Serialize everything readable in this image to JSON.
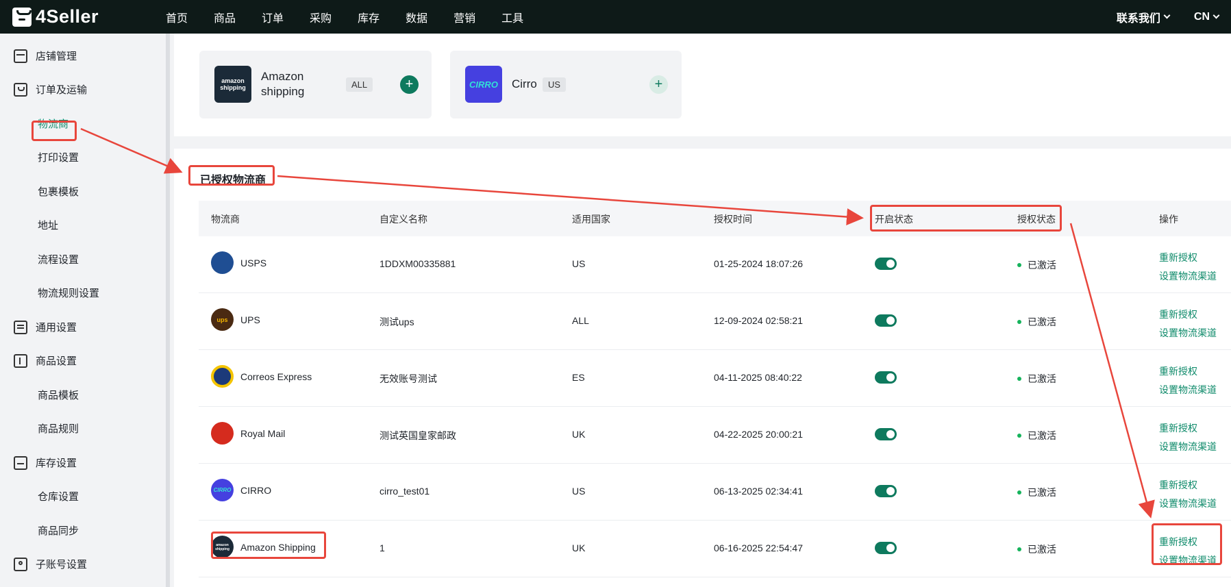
{
  "app": {
    "logo": "4Seller"
  },
  "topnav": [
    "首页",
    "商品",
    "订单",
    "采购",
    "库存",
    "数据",
    "营销",
    "工具"
  ],
  "top_right": {
    "contact": "联系我们",
    "lang": "CN"
  },
  "sidebar": {
    "items": [
      {
        "label": "店铺管理",
        "level": 1,
        "icon": "store-icon"
      },
      {
        "label": "订单及运输",
        "level": 1,
        "icon": "bag-icon"
      },
      {
        "label": "物流商",
        "level": 2,
        "active": true
      },
      {
        "label": "打印设置",
        "level": 2
      },
      {
        "label": "包裹模板",
        "level": 2
      },
      {
        "label": "地址",
        "level": 2
      },
      {
        "label": "流程设置",
        "level": 2
      },
      {
        "label": "物流规则设置",
        "level": 2
      },
      {
        "label": "通用设置",
        "level": 1,
        "icon": "document-icon"
      },
      {
        "label": "商品设置",
        "level": 1,
        "icon": "upload-icon"
      },
      {
        "label": "商品模板",
        "level": 2
      },
      {
        "label": "商品规则",
        "level": 2
      },
      {
        "label": "库存设置",
        "level": 1,
        "icon": "warehouse-icon"
      },
      {
        "label": "仓库设置",
        "level": 2
      },
      {
        "label": "商品同步",
        "level": 2
      },
      {
        "label": "子账号设置",
        "level": 1,
        "icon": "user-icon"
      }
    ]
  },
  "carrier_cards": [
    {
      "name": "Amazon shipping",
      "tag": "ALL",
      "logo_text": "amazon shipping",
      "logo_color": "#1b2a38"
    },
    {
      "name": "Cirro",
      "tag": "US",
      "logo_text": "CIRRO",
      "logo_color": "#4540e0"
    }
  ],
  "section_title": "已授权物流商",
  "table": {
    "headers": [
      "物流商",
      "自定义名称",
      "适用国家",
      "授权时间",
      "开启状态",
      "授权状态",
      "操作"
    ],
    "rows": [
      {
        "carrier": "USPS",
        "custom": "1DDXM00335881",
        "country": "US",
        "time": "01-25-2024 18:07:26",
        "status": "已激活",
        "op1": "重新授权",
        "op2": "设置物流渠道",
        "logo_color": "#1f4e93",
        "logo_text": ""
      },
      {
        "carrier": "UPS",
        "custom": "测试ups",
        "country": "ALL",
        "time": "12-09-2024 02:58:21",
        "status": "已激活",
        "op1": "重新授权",
        "op2": "设置物流渠道",
        "logo_color": "#4a2a12",
        "logo_text": "ups"
      },
      {
        "carrier": "Correos Express",
        "custom": "无效账号测试",
        "country": "ES",
        "time": "04-11-2025 08:40:22",
        "status": "已激活",
        "op1": "重新授权",
        "op2": "设置物流渠道",
        "logo_color": "#1c3a7a",
        "logo_text": ""
      },
      {
        "carrier": "Royal Mail",
        "custom": "测试英国皇家邮政",
        "country": "UK",
        "time": "04-22-2025 20:00:21",
        "status": "已激活",
        "op1": "重新授权",
        "op2": "设置物流渠道",
        "logo_color": "#d52b1e",
        "logo_text": ""
      },
      {
        "carrier": "CIRRO",
        "custom": "cirro_test01",
        "country": "US",
        "time": "06-13-2025 02:34:41",
        "status": "已激活",
        "op1": "重新授权",
        "op2": "设置物流渠道",
        "logo_color": "#4540e0",
        "logo_text": "CIRRO"
      },
      {
        "carrier": "Amazon Shipping",
        "custom": "1",
        "country": "UK",
        "time": "06-16-2025 22:54:47",
        "status": "已激活",
        "op1": "重新授权",
        "op2": "设置物流渠道",
        "logo_color": "#1b2a38",
        "logo_text": "amazon shipping"
      }
    ]
  },
  "colors": {
    "accent": "#0e8a6a",
    "topbar": "#0e1a18",
    "annotation": "#e8463c",
    "active_dot": "#16b35c"
  }
}
